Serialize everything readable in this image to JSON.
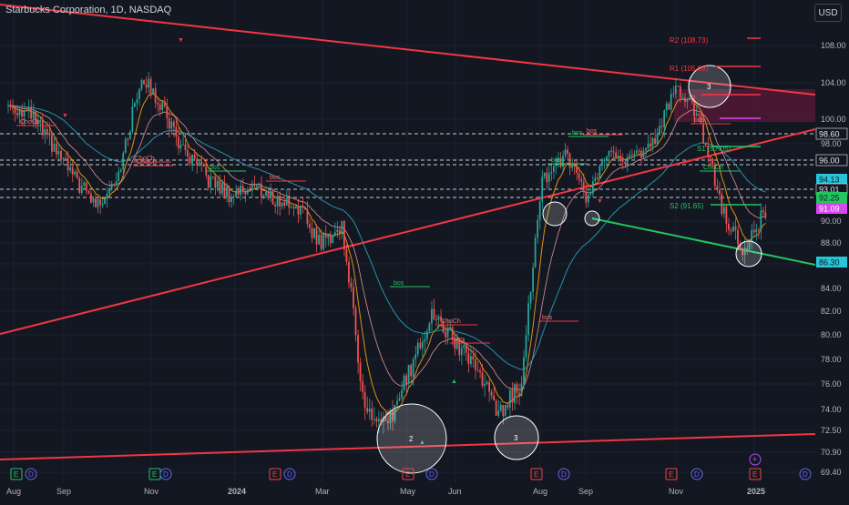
{
  "header": {
    "title": "Starbucks Corporation, 1D, NASDAQ",
    "currency": "USD"
  },
  "chart_data": {
    "type": "candlestick",
    "x_labels": [
      "Aug",
      "Sep",
      "Nov",
      "2024",
      "Mar",
      "May",
      "Jun",
      "Aug",
      "Sep",
      "Nov",
      "2025"
    ],
    "y_ticks": [
      108.0,
      104.0,
      100.0,
      98.0,
      96.0,
      90.0,
      88.0,
      86.0,
      84.0,
      82.0,
      80.0,
      78.0,
      76.0,
      74.0,
      72.5,
      70.9,
      69.4
    ],
    "price_tags": [
      {
        "value": "98.60",
        "kind": "white"
      },
      {
        "value": "96.00",
        "kind": "white"
      },
      {
        "value": "94.13",
        "kind": "teal"
      },
      {
        "value": "93.01",
        "kind": "white"
      },
      {
        "value": "92.25",
        "kind": "green"
      },
      {
        "value": "91.09",
        "kind": "magenta"
      },
      {
        "value": "86.30",
        "kind": "teal"
      }
    ],
    "pivot_labels": [
      {
        "text": "R2 (108.73)",
        "color": "#f23645"
      },
      {
        "text": "R1 (105.09)",
        "color": "#f23645"
      },
      {
        "text": "S1 (97.05)",
        "color": "#22c55e"
      },
      {
        "text": "S2 (91.65)",
        "color": "#22c55e"
      }
    ],
    "structure_labels": [
      "ChoCh",
      "bos",
      "ChoCh",
      "bos",
      "bos",
      "bos",
      "ChoCh",
      "bos",
      "bos",
      "bos",
      "ChoCh",
      "bos",
      "ChoCh",
      "bos"
    ],
    "circle_labels": [
      "2",
      "3",
      "3"
    ],
    "price_path": [
      {
        "x": "Aug",
        "y": 101.5
      },
      {
        "x": "Aug",
        "y": 100.5
      },
      {
        "x": "Sep",
        "y": 97.5
      },
      {
        "x": "Sep",
        "y": 94.0
      },
      {
        "x": "Oct",
        "y": 91.5
      },
      {
        "x": "Oct",
        "y": 95.0
      },
      {
        "x": "Nov",
        "y": 104.8
      },
      {
        "x": "Nov",
        "y": 101.0
      },
      {
        "x": "Dec",
        "y": 96.5
      },
      {
        "x": "Dec",
        "y": 94.0
      },
      {
        "x": "2024",
        "y": 92.5
      },
      {
        "x": "Feb",
        "y": 93.5
      },
      {
        "x": "Feb",
        "y": 92.0
      },
      {
        "x": "Mar",
        "y": 91.5
      },
      {
        "x": "Apr",
        "y": 88.0
      },
      {
        "x": "Apr",
        "y": 89.5
      },
      {
        "x": "May",
        "y": 74.0
      },
      {
        "x": "May",
        "y": 72.5
      },
      {
        "x": "May",
        "y": 77.0
      },
      {
        "x": "Jun",
        "y": 81.8
      },
      {
        "x": "Jun",
        "y": 79.5
      },
      {
        "x": "Jul",
        "y": 77.5
      },
      {
        "x": "Jul",
        "y": 73.5
      },
      {
        "x": "Jul",
        "y": 76.0
      },
      {
        "x": "Aug",
        "y": 94.0
      },
      {
        "x": "Aug",
        "y": 96.5
      },
      {
        "x": "Sep",
        "y": 92.0
      },
      {
        "x": "Sep",
        "y": 97.0
      },
      {
        "x": "Oct",
        "y": 96.0
      },
      {
        "x": "Oct",
        "y": 98.0
      },
      {
        "x": "Nov",
        "y": 103.5
      },
      {
        "x": "Nov",
        "y": 100.5
      },
      {
        "x": "Dec",
        "y": 91.5
      },
      {
        "x": "Dec",
        "y": 87.0
      },
      {
        "x": "Dec",
        "y": 91.09
      }
    ],
    "event_markers": [
      "E",
      "D",
      "E",
      "D",
      "E",
      "D",
      "E",
      "D",
      "E",
      "D",
      "E",
      "D",
      "E",
      "D"
    ],
    "colors": {
      "up": "#26a69a",
      "down": "#ef5350",
      "trend": "#f23645",
      "support": "#22c55e",
      "ema": "#2a9fb8",
      "ema2": "#f59e0b",
      "zone": "#5b1a3a"
    }
  }
}
